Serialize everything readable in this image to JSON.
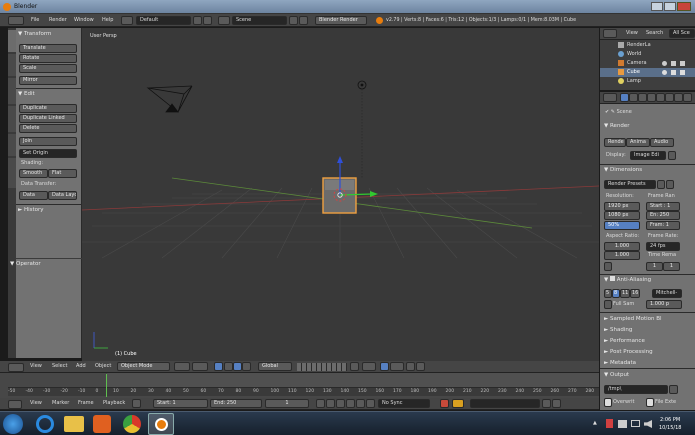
{
  "window": {
    "title": "Blender"
  },
  "info_bar": {
    "menus": [
      "File",
      "Render",
      "Window",
      "Help"
    ],
    "screen_layout": "Default",
    "scene": "Scene",
    "engine": "Blender Render",
    "stats": "v2.79 | Verts:8 | Faces:6 | Tris:12 | Objects:1/3 | Lamps:0/1 | Mem:8.03M | Cube"
  },
  "tool_shelf": {
    "transform_header": "Transform",
    "transform_buttons": [
      "Translate",
      "Rotate",
      "Scale"
    ],
    "mirror": "Mirror",
    "edit_header": "Edit",
    "edit_buttons": [
      "Duplicate",
      "Duplicate Linked",
      "Delete"
    ],
    "join": "Join",
    "set_origin": "Set Origin",
    "shading_label": "Shading:",
    "smooth": "Smooth",
    "flat": "Flat",
    "data_transfer_label": "Data Transfer:",
    "data": "Data",
    "data_layout": "Data Layo",
    "history_header": "History",
    "operator_header": "Operator",
    "tabs": [
      "Tools",
      "Create",
      "Relations",
      "Animation",
      "Physics",
      "Grease Pencil"
    ]
  },
  "viewport": {
    "label": "User Persp",
    "object_label": "(1) Cube"
  },
  "viewport_header": {
    "menus": [
      "View",
      "Select",
      "Add",
      "Object"
    ],
    "mode": "Object Mode",
    "orientation": "Global"
  },
  "timeline": {
    "ruler_labels": [
      "-50",
      "-40",
      "-30",
      "-20",
      "-10",
      "0",
      "10",
      "20",
      "30",
      "40",
      "50",
      "60",
      "70",
      "80",
      "90",
      "100",
      "110",
      "120",
      "130",
      "140",
      "150",
      "160",
      "170",
      "180",
      "190",
      "200",
      "210",
      "220",
      "230",
      "240",
      "250",
      "260",
      "270",
      "280"
    ],
    "menus": [
      "View",
      "Marker",
      "Frame",
      "Playback"
    ],
    "start_label": "Start:",
    "start_value": "1",
    "end_label": "End:",
    "end_value": "250",
    "current": "1",
    "sync": "No Sync"
  },
  "outliner": {
    "menus": [
      "View",
      "Search",
      "All Sce"
    ],
    "items": [
      "RenderLa",
      "World",
      "Camera",
      "Cube",
      "Lamp"
    ]
  },
  "properties": {
    "scene": "Scene",
    "render_header": "Render",
    "render_btn": "Rende",
    "animation_btn": "Anima",
    "audio_btn": "Audio",
    "display_label": "Display:",
    "display_value": "Image Edi",
    "dimensions_header": "Dimensions",
    "render_presets": "Render Presets",
    "resolution_label": "Resolution:",
    "frame_range_label": "Frame Ran",
    "res_x": "1920 px",
    "res_y": "1080 px",
    "res_pct": "50%",
    "frame_start": "Start : 1",
    "frame_end": "En: 250",
    "frame_step": "Fram: 1",
    "aspect_label": "Aspect Ratio:",
    "frame_rate_label": "Frame Rate:",
    "aspect_x": "1.000",
    "aspect_y": "1.000",
    "fps": "24 fps",
    "time_remap_label": "Time Rema",
    "remap_old": "1",
    "remap_new": "1",
    "anti_aliasing_header": "Anti-Aliasing",
    "aa_samples": [
      "5",
      "8",
      "11",
      "16"
    ],
    "filter": "Mitchell-",
    "full_sample": "Full Sam",
    "filter_size": "1.000 p",
    "panels": [
      "Sampled Motion Bl",
      "Shading",
      "Performance",
      "Post Processing",
      "Metadata",
      "Output"
    ],
    "output_path": "/tmp\\",
    "overwrite": "Overwrit",
    "file_extensions": "File Exte"
  },
  "taskbar": {
    "time": "2:06 PM",
    "date": "10/15/18"
  },
  "colors": {
    "accent_blue": "#5680c2",
    "selection_orange": "#f0a040",
    "viewport_bg": "#393939",
    "panel_bg": "#727272"
  }
}
